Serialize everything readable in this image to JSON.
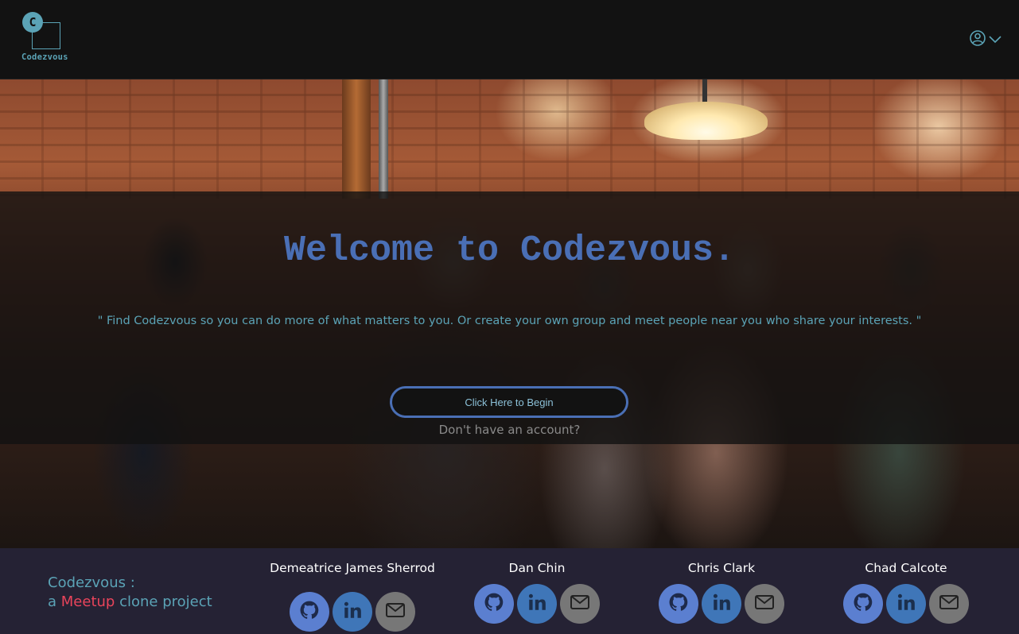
{
  "header": {
    "logo_letter": "C",
    "logo_text": "Codezvous",
    "user_menu_icon": "user-circle-icon",
    "user_menu_chevron": "chevron-down-icon"
  },
  "hero": {
    "title": "Welcome to Codezvous.",
    "quote": "\" Find Codezvous so you can do more of what matters to you. Or create your own group and meet people near you who share your interests. \"",
    "begin_button": "Click Here to Begin",
    "signup_link": "Don't have an account?"
  },
  "footer": {
    "tagline_line1": "Codezvous :",
    "tagline_prefix": "a",
    "tagline_brand": "Meetup",
    "tagline_suffix": "clone project",
    "members": [
      {
        "name": "Demeatrice James Sherrod",
        "icons": [
          "github-icon",
          "linkedin-icon",
          "email-icon"
        ]
      },
      {
        "name": "Dan Chin",
        "icons": [
          "github-icon",
          "linkedin-icon",
          "email-icon"
        ]
      },
      {
        "name": "Chris Clark",
        "icons": [
          "github-icon",
          "linkedin-icon",
          "email-icon"
        ]
      },
      {
        "name": "Chad Calcote",
        "icons": [
          "github-icon",
          "linkedin-icon",
          "email-icon"
        ]
      }
    ]
  },
  "colors": {
    "accent_teal": "#5ba3b6",
    "accent_blue": "#4a6fb5",
    "brand_red": "#e9445b",
    "footer_bg": "#252234",
    "header_bg": "#121212"
  }
}
